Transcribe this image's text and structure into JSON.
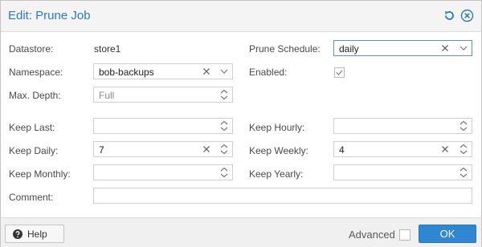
{
  "dialog": {
    "title": "Edit: Prune Job",
    "reset_icon": "reset-icon",
    "close_icon": "close-icon"
  },
  "form": {
    "datastore": {
      "label": "Datastore:",
      "value": "store1"
    },
    "namespace": {
      "label": "Namespace:",
      "value": "bob-backups"
    },
    "max_depth": {
      "label": "Max. Depth:",
      "placeholder": "Full",
      "value": ""
    },
    "prune_schedule": {
      "label": "Prune Schedule:",
      "value": "daily"
    },
    "enabled": {
      "label": "Enabled:",
      "checked": true
    },
    "keep_last": {
      "label": "Keep Last:",
      "value": ""
    },
    "keep_daily": {
      "label": "Keep Daily:",
      "value": "7"
    },
    "keep_monthly": {
      "label": "Keep Monthly:",
      "value": ""
    },
    "keep_hourly": {
      "label": "Keep Hourly:",
      "value": ""
    },
    "keep_weekly": {
      "label": "Keep Weekly:",
      "value": "4"
    },
    "keep_yearly": {
      "label": "Keep Yearly:",
      "value": ""
    },
    "comment": {
      "label": "Comment:",
      "value": ""
    }
  },
  "footer": {
    "help_label": "Help",
    "advanced_label": "Advanced",
    "advanced_checked": false,
    "ok_label": "OK"
  },
  "colors": {
    "title": "#2d78bd",
    "accent": "#2f87d4",
    "focus_border": "#5a93d1"
  }
}
